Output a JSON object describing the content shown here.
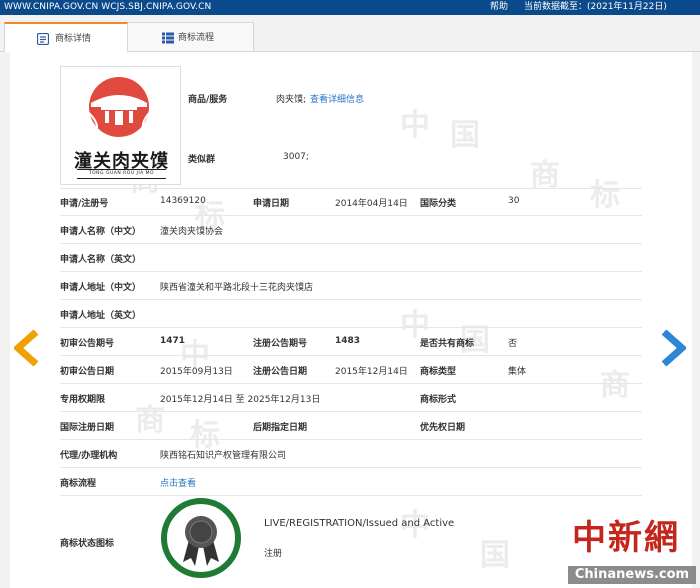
{
  "topbar": {
    "domains": "WWW.CNIPA.GOV.CN WCJS.SBJ.CNIPA.GOV.CN",
    "help": "帮助",
    "date_label": "当前数据截至：(2021年11月22日)"
  },
  "tabs": [
    {
      "label": "商标详情",
      "active": true
    },
    {
      "label": "商标流程",
      "active": false
    }
  ],
  "logo": {
    "text": "潼关肉夹馍",
    "subtext": "TONG GUAN ROU JIA MO"
  },
  "goods": {
    "label": "商品/服务",
    "value": "肉夹馍;",
    "link": "查看详细信息"
  },
  "similar": {
    "label": "类似群",
    "value": "3007;"
  },
  "fields": {
    "reg_no": {
      "label": "申请/注册号",
      "value": "14369120"
    },
    "app_date": {
      "label": "申请日期",
      "value": "2014年04月14日"
    },
    "intl_class": {
      "label": "国际分类",
      "value": "30"
    },
    "applicant_cn": {
      "label": "申请人名称（中文）",
      "value": "潼关肉夹馍协会"
    },
    "applicant_en": {
      "label": "申请人名称（英文）",
      "value": ""
    },
    "address_cn": {
      "label": "申请人地址（中文）",
      "value": "陕西省潼关和平路北段十三花肉夹馍店"
    },
    "address_en": {
      "label": "申请人地址（英文）",
      "value": ""
    },
    "prelim_issue": {
      "label": "初审公告期号",
      "value": "1471"
    },
    "reg_issue": {
      "label": "注册公告期号",
      "value": "1483"
    },
    "shared": {
      "label": "是否共有商标",
      "value": "否"
    },
    "prelim_date": {
      "label": "初审公告日期",
      "value": "2015年09月13日"
    },
    "reg_date": {
      "label": "注册公告日期",
      "value": "2015年12月14日"
    },
    "mark_type": {
      "label": "商标类型",
      "value": "集体"
    },
    "exclusive": {
      "label": "专用权期限",
      "value": "2015年12月14日 至 2025年12月13日"
    },
    "mark_form": {
      "label": "商标形式",
      "value": ""
    },
    "intl_reg_date": {
      "label": "国际注册日期",
      "value": ""
    },
    "later_date": {
      "label": "后期指定日期",
      "value": ""
    },
    "priority_date": {
      "label": "优先权日期",
      "value": ""
    },
    "agent": {
      "label": "代理/办理机构",
      "value": "陕西铭石知识产权管理有限公司"
    },
    "process": {
      "label": "商标流程",
      "link": "点击查看"
    },
    "status_icon": {
      "label": "商标状态图标"
    }
  },
  "status": {
    "english": "LIVE/REGISTRATION/Issued and Active",
    "chinese": "注册"
  },
  "watermark": {
    "logo": "中新網",
    "url": "Chinanews.com"
  },
  "colors": {
    "topbar": "#0a4a8a",
    "tab_accent": "#f08a24",
    "link": "#2a73c7",
    "arrow_left": "#f0a000",
    "arrow_right": "#2d86d6",
    "badge": "#1f7a34",
    "news_red": "#c4261d"
  }
}
